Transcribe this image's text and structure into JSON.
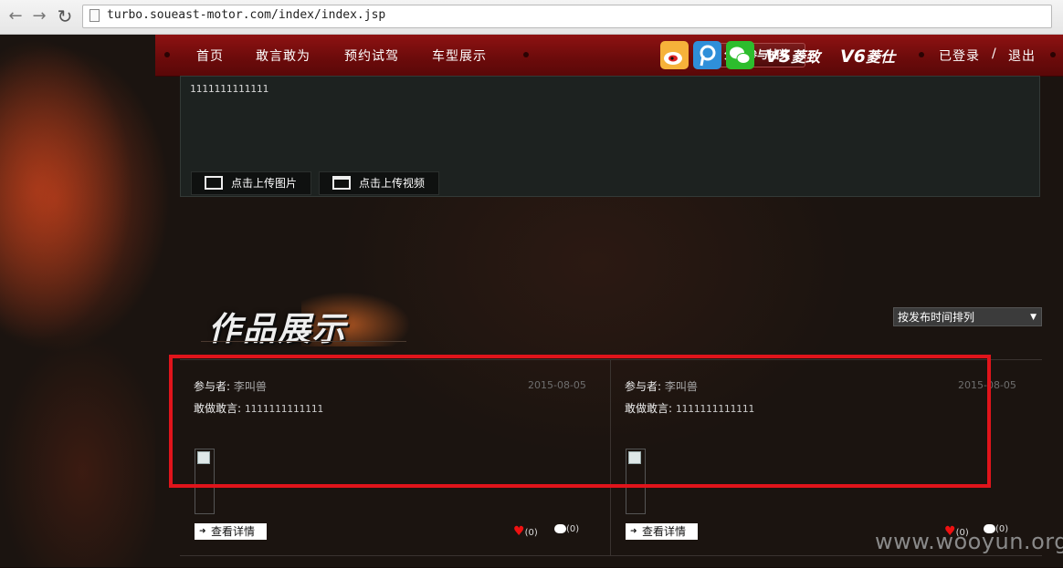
{
  "browser": {
    "url": "turbo.soueast-motor.com/index/index.jsp"
  },
  "nav": {
    "items": [
      "首页",
      "敢言敢为",
      "预约试驾",
      "车型展示"
    ],
    "share_label": "分享参与抽奖",
    "social": [
      {
        "name": "weibo-icon",
        "color": "#f5a623"
      },
      {
        "name": "tencent-weibo-icon",
        "color": "#2e8fd8"
      },
      {
        "name": "wechat-icon",
        "color": "#2dbd2d"
      }
    ],
    "brands": [
      {
        "mark": "V5",
        "text": "菱致"
      },
      {
        "mark": "V6",
        "text": "菱仕"
      }
    ],
    "login": "已登录",
    "separator": "/",
    "logout": "退出"
  },
  "entry": {
    "text": "1111111111111",
    "upload_image": "点击上传图片",
    "upload_video": "点击上传视频"
  },
  "section": {
    "title": "作品展示",
    "sort": "按发布时间排列"
  },
  "works": [
    {
      "participant_label": "参与者:",
      "participant": "李叫兽",
      "date": "2015-08-05",
      "statement_label": "敢做敢言:",
      "statement": "1111111111111",
      "detail": "查看详情",
      "likes": "(0)",
      "comments": "(0)"
    },
    {
      "participant_label": "参与者:",
      "participant": "李叫兽",
      "date": "2015-08-05",
      "statement_label": "敢做敢言:",
      "statement": "1111111111111",
      "detail": "查看详情",
      "likes": "(0)",
      "comments": "(0)"
    }
  ],
  "watermark": "www.wooyun.org"
}
